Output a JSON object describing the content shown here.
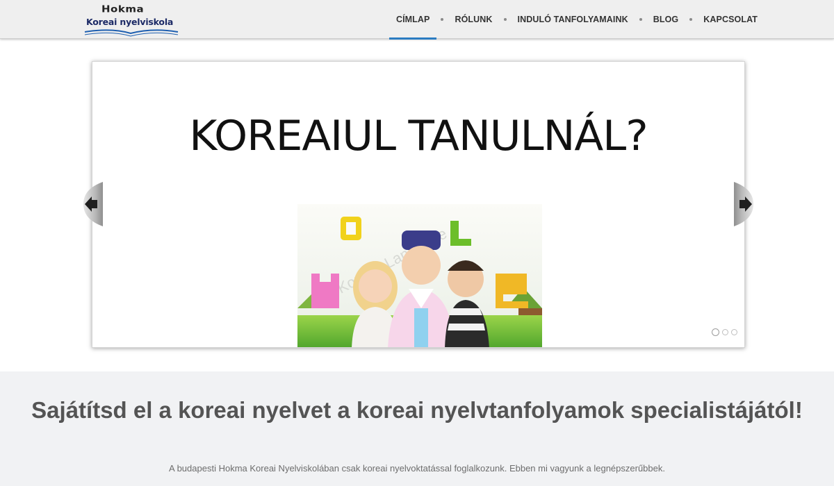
{
  "header": {
    "logo": {
      "line1": "Hokma",
      "line2": "Koreai nyelviskola"
    },
    "nav": [
      {
        "label": "CÍMLAP",
        "active": true
      },
      {
        "label": "RÓLUNK",
        "active": false
      },
      {
        "label": "INDULÓ TANFOLYAMAINK",
        "active": false
      },
      {
        "label": "BLOG",
        "active": false
      },
      {
        "label": "KAPCSOLAT",
        "active": false
      }
    ],
    "accent_color": "#2b7cc1"
  },
  "slider": {
    "headline": "KOREAIUL TANULNÁL?",
    "image_text": "Korean Language",
    "slides_count": 3,
    "active_slide": 1,
    "icons": {
      "prev": "arrow-left-icon",
      "next": "arrow-right-icon"
    }
  },
  "intro": {
    "title": "Sajátítsd el a koreai nyelvet a koreai nyelvtanfolyamok specialistájától!",
    "text": "A budapesti Hokma Koreai Nyelviskolában csak koreai nyelvoktatással foglalkozunk. Ebben mi vagyunk a legnépszerűbbek."
  }
}
